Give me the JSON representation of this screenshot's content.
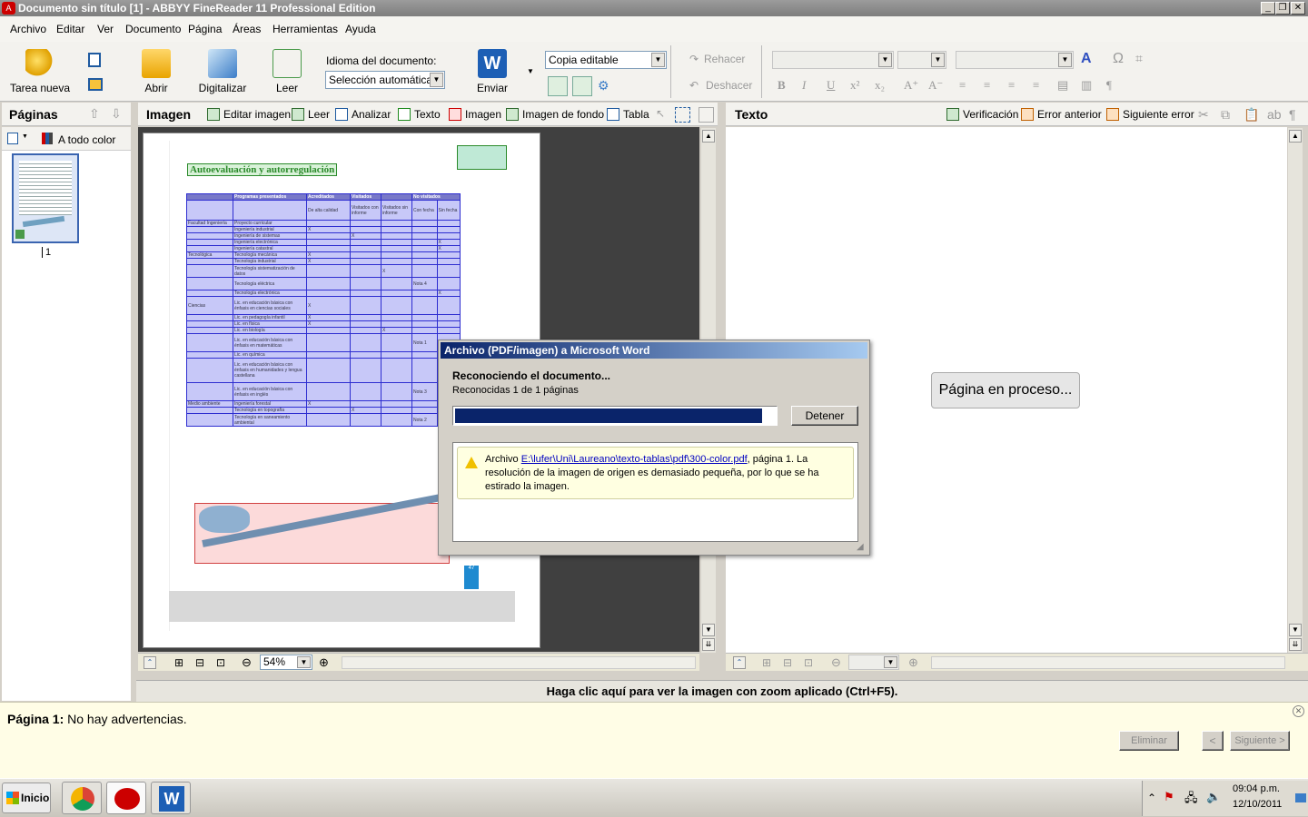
{
  "window": {
    "title": "Documento sin título [1] - ABBYY FineReader 11 Professional Edition"
  },
  "menu": [
    "Archivo",
    "Editar",
    "Ver",
    "Documento",
    "Página",
    "Áreas",
    "Herramientas",
    "Ayuda"
  ],
  "toolbar": {
    "new_task": "Tarea nueva",
    "open": "Abrir",
    "scan": "Digitalizar",
    "read": "Leer",
    "doc_lang_label": "Idioma del documento:",
    "doc_lang_value": "Selección automática",
    "send": "Enviar",
    "copy_mode": "Copia editable",
    "redo": "Rehacer",
    "undo": "Deshacer"
  },
  "pages_pane": {
    "title": "Páginas",
    "color_mode": "A todo color",
    "page_number": "1"
  },
  "image_pane": {
    "title": "Imagen",
    "edit_image": "Editar imagen",
    "read": "Leer",
    "analyze": "Analizar",
    "text": "Texto",
    "image": "Imagen",
    "background": "Imagen de fondo",
    "table": "Tabla",
    "zoom": "54%",
    "doc_heading": "Autoevaluación y autorregulación",
    "table_headers": [
      "Programas presentados",
      "Acreditados",
      "Visitados",
      "No visitados"
    ],
    "table_sub": [
      "De alta calidad",
      "Visitados con informe",
      "Visitados sin informe",
      "Con fecha",
      "Sin fecha"
    ],
    "table_groups": [
      "Facultad Ingeniería",
      "Tecnológica",
      "Ciencias",
      "Medio ambiente"
    ],
    "table_rows": [
      "Proyecto curricular",
      "Ingeniería industrial",
      "Ingeniería de sistemas",
      "Ingeniería electrónica",
      "Ingeniería catastral",
      "Tecnología mecánica",
      "Tecnología industrial",
      "Tecnología sistematización de datos",
      "Tecnología eléctrica",
      "Tecnología electrónica",
      "Lic. en educación básica con énfasis en ciencias sociales",
      "Lic. en pedagogía infantil",
      "Lic. en física",
      "Lic. en biología",
      "Lic. en educación básica con énfasis en matemáticas",
      "Lic. en química",
      "Lic. en educación básica con énfasis en humanidades y lengua castellana",
      "Lic. en educación básica con énfasis en inglés",
      "Ingeniería forestal",
      "Tecnología en topografía",
      "Tecnología en saneamiento ambiental"
    ],
    "marks": [
      "X",
      "Nota 4",
      "Nota 1",
      "Nota 3",
      "Nota 2",
      "47"
    ]
  },
  "text_pane": {
    "title": "Texto",
    "verify": "Verificación",
    "prev_error": "Error anterior",
    "next_error": "Siguiente error",
    "processing": "Página en proceso..."
  },
  "dialog": {
    "title": "Archivo (PDF/imagen) a Microsoft Word",
    "status": "Reconociendo el documento...",
    "progress_text": "Reconocidas 1 de 1 páginas",
    "progress": 0.96,
    "stop": "Detener",
    "warn_prefix": "Archivo ",
    "warn_link": "E:\\lufer\\Uni\\Laureano\\texto-tablas\\pdf\\300-color.pdf",
    "warn_rest": ", página 1. La resolución de la imagen de origen es demasiado pequeña, por lo que se ha estirado la imagen."
  },
  "zoom_tip": "Haga clic aquí para ver la imagen con zoom aplicado (Ctrl+F5).",
  "warnings": {
    "page_label": "Página 1:",
    "message": "No hay advertencias.",
    "delete": "Eliminar",
    "prev": "<",
    "next": "Siguiente >"
  },
  "taskbar": {
    "start": "Inicio",
    "time": "09:04 p.m.",
    "date": "12/10/2011"
  }
}
